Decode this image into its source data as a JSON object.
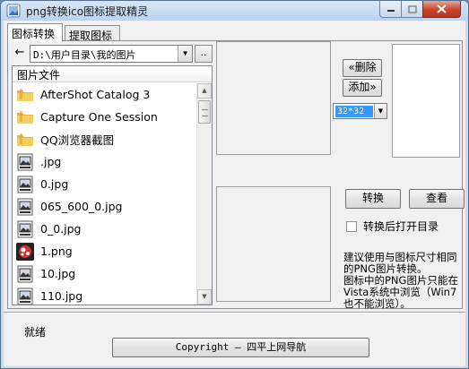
{
  "window": {
    "title": "png转换ico图标提取精灵"
  },
  "tabs": [
    {
      "label": "图标转换",
      "active": true
    },
    {
      "label": "提取图标",
      "active": false
    }
  ],
  "path_bar": {
    "back_label": "←",
    "path": "D:\\用户目录\\我的图片",
    "browse_label": ".."
  },
  "file_list": {
    "header": "图片文件",
    "items": [
      {
        "name": "AfterShot Catalog 3",
        "icon": "folder-icon"
      },
      {
        "name": "Capture One Session",
        "icon": "folder-icon"
      },
      {
        "name": "QQ浏览器截图",
        "icon": "folder-icon"
      },
      {
        "name": ".jpg",
        "icon": "image-file-icon"
      },
      {
        "name": "0.jpg",
        "icon": "image-file-icon"
      },
      {
        "name": "065_600_0.jpg",
        "icon": "image-file-icon"
      },
      {
        "name": "0_0.jpg",
        "icon": "image-file-icon"
      },
      {
        "name": "1.png",
        "icon": "png-thumbnail-icon"
      },
      {
        "name": "10.jpg",
        "icon": "image-file-icon"
      },
      {
        "name": "110.jpg",
        "icon": "image-file-icon"
      }
    ]
  },
  "controls": {
    "delete_label": "«删除",
    "add_label": "添加»",
    "size_value": "32*32",
    "convert_label": "转换",
    "view_label": "查看",
    "open_after_label": "转换后打开目录",
    "open_after_checked": false,
    "hint_line1": "建议使用与图标尺寸相同的PNG图片转换。",
    "hint_line2": "图标中的PNG图片只能在Vista系统中浏览（Win7也不能浏览）。"
  },
  "status": {
    "text": "就绪"
  },
  "footer": {
    "copyright": "Copyright — 四平上网导航"
  },
  "colors": {
    "selection": "#3399ff",
    "close_button": "#c8452c",
    "frame": "#c9dcf2"
  }
}
